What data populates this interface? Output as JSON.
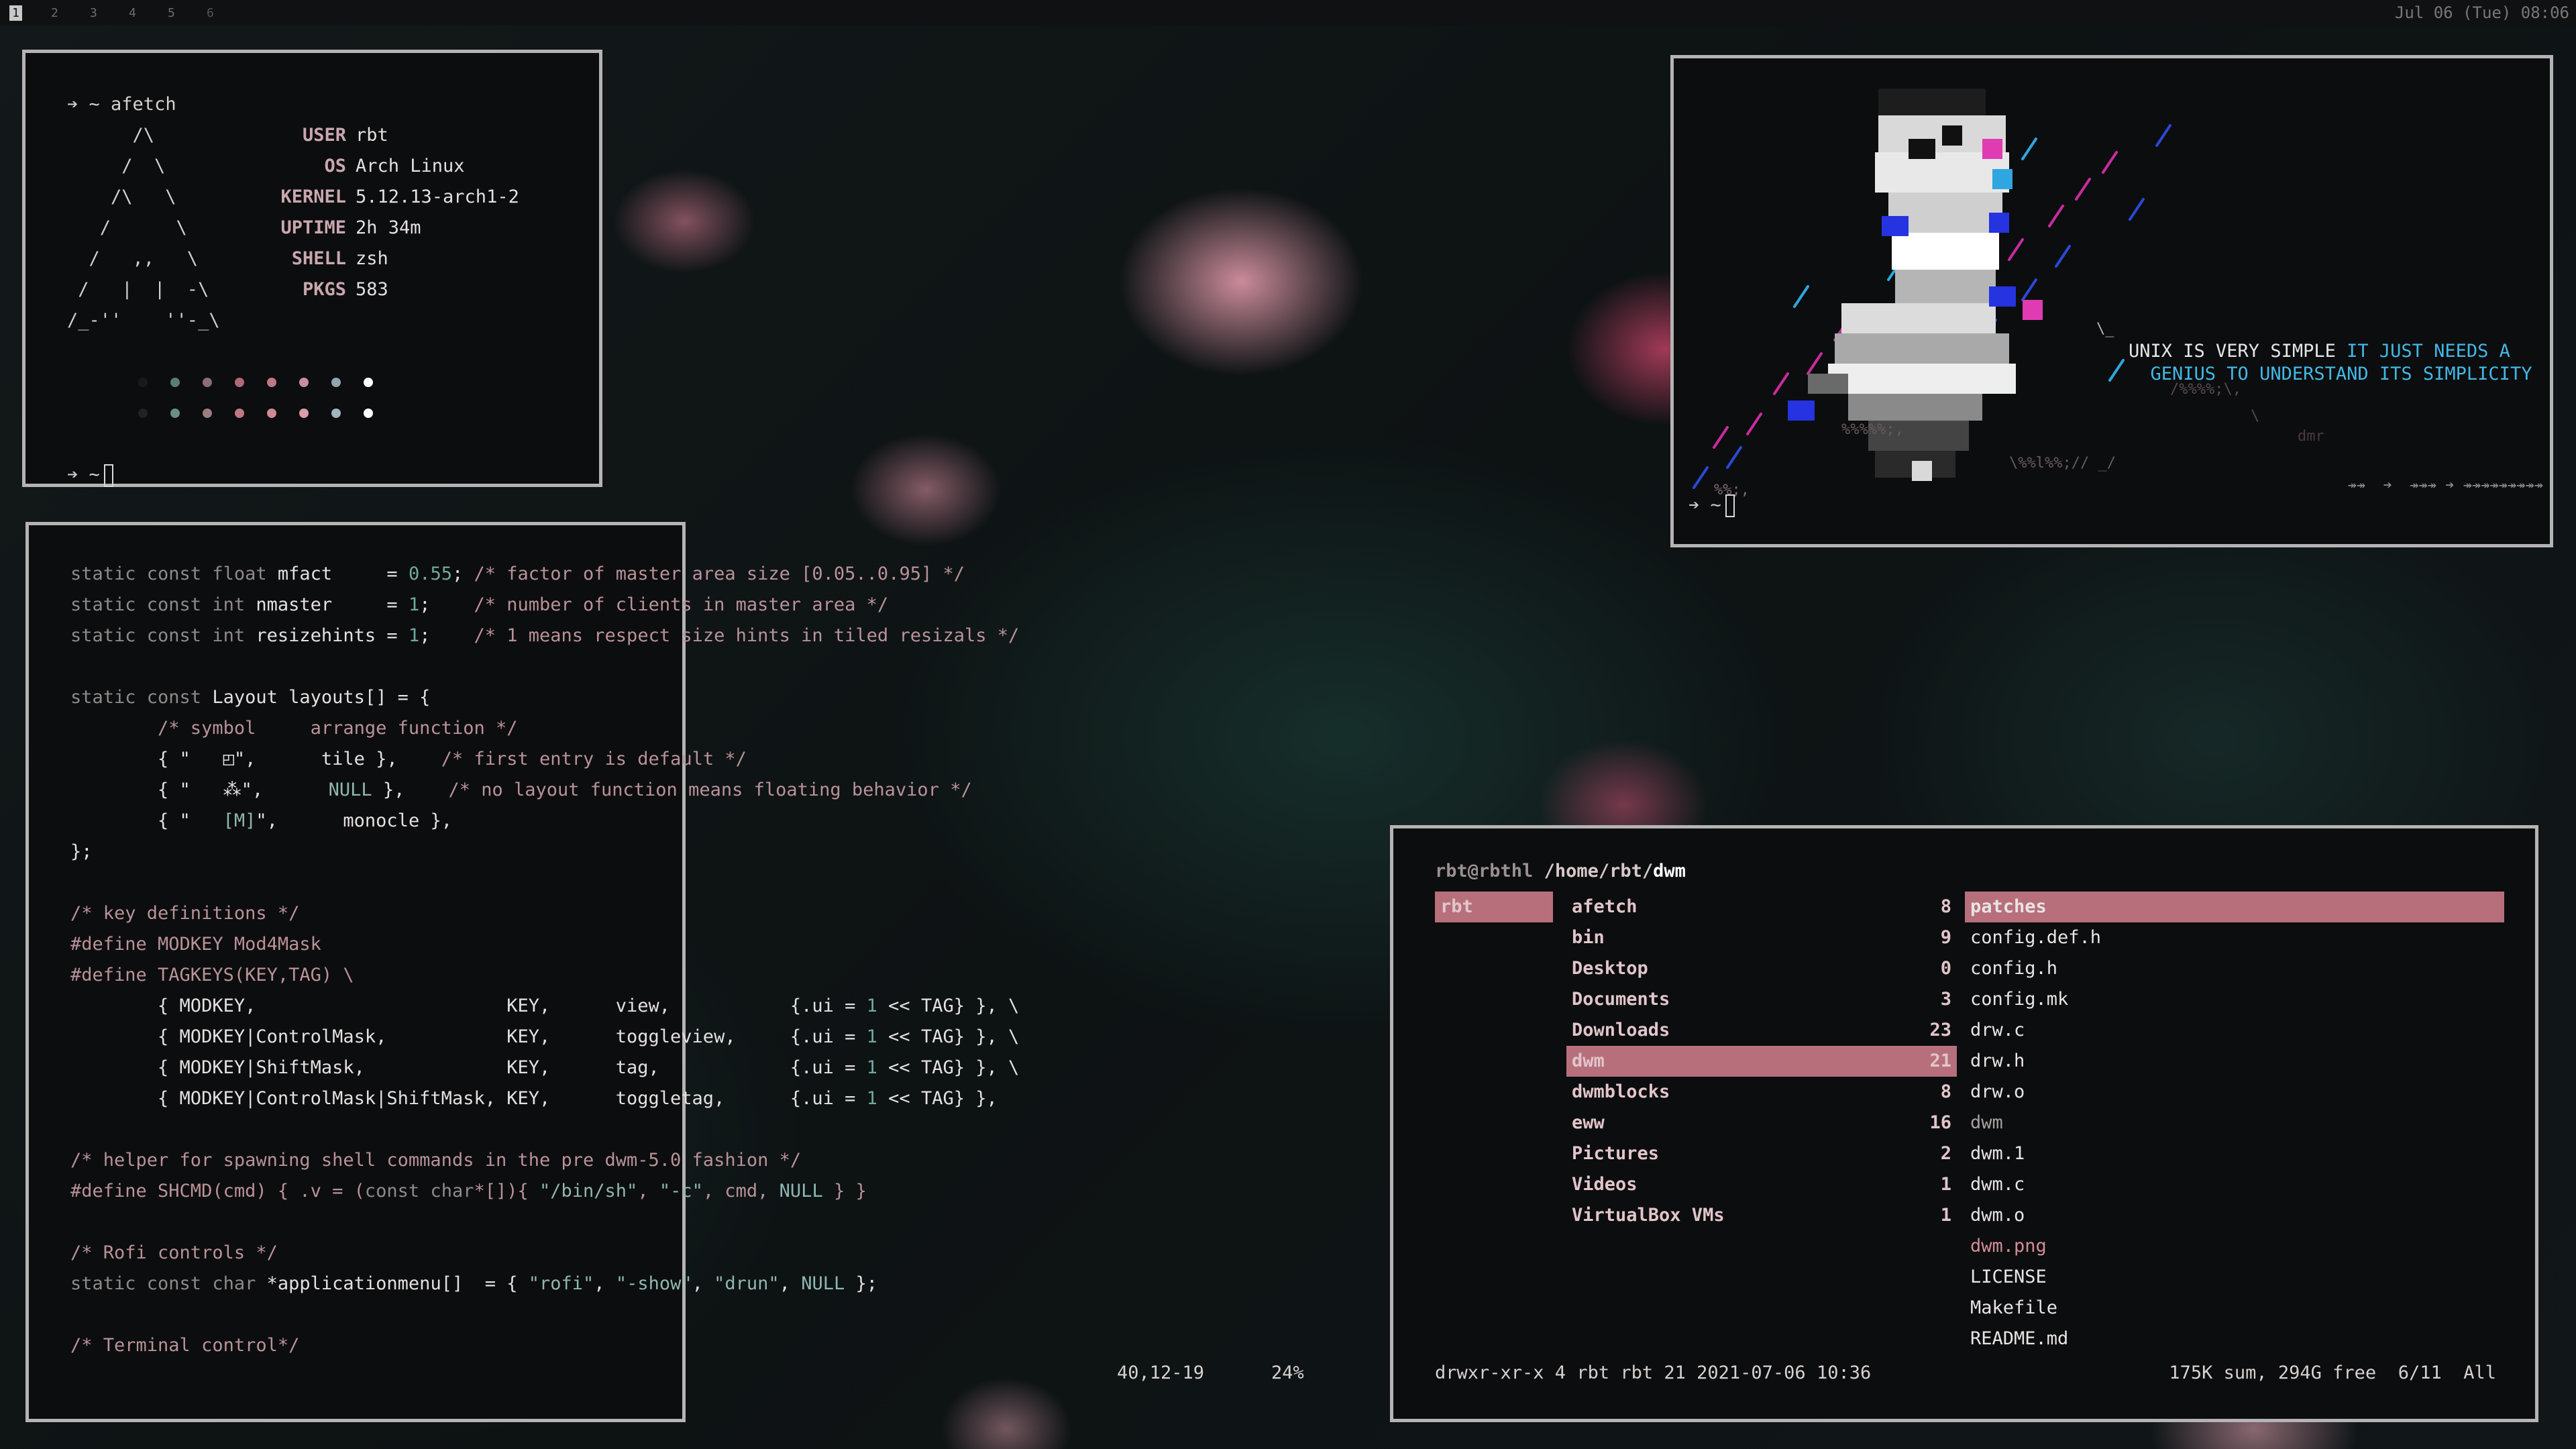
{
  "bar": {
    "tags": [
      "1",
      "2",
      "3",
      "4",
      "5",
      "6"
    ],
    "clock": "Jul 06 (Tue) 08:06"
  },
  "afetch": {
    "prompt_arrow": "➔",
    "command": "~ afetch",
    "rows": [
      {
        "art": "      /\\",
        "key": "USER",
        "value": "rbt"
      },
      {
        "art": "     /  \\",
        "key": "OS",
        "value": "Arch Linux"
      },
      {
        "art": "    /\\   \\",
        "key": "KERNEL",
        "value": "5.12.13-arch1-2"
      },
      {
        "art": "   /      \\",
        "key": "UPTIME",
        "value": "2h 34m"
      },
      {
        "art": "  /   ,,   \\",
        "key": "SHELL",
        "value": "zsh"
      },
      {
        "art": " /   |  |  -\\",
        "key": "PKGS",
        "value": "583"
      },
      {
        "art": "/_-''    ''-_\\",
        "key": "",
        "value": ""
      }
    ],
    "palette_row1": [
      "#1a1a1a",
      "#5a7f72",
      "#8a6e72",
      "#b06878",
      "#c07888",
      "#c98e9c",
      "#8fa6ad",
      "#ffffff"
    ],
    "palette_row2": [
      "#222222",
      "#6a9082",
      "#9a7e82",
      "#c07888",
      "#d08898",
      "#d99eac",
      "#9fb6bd",
      "#ffffff"
    ],
    "prompt_tilde": "~"
  },
  "art": {
    "quote_white_1": "UNIX IS VERY SIMPLE ",
    "quote_cyan_1": "IT JUST NEEDS A",
    "quote_cyan_2": "  GENIUS TO UNDERSTAND ITS SIMPLICITY",
    "prompt_arrow": "➔",
    "prompt_tilde": "~",
    "arrows": "↠↠  ➔  ↠↠↠ ➔ ↠↠↠↠↠↠↠↠↠"
  },
  "editor": {
    "l1": {
      "a": "static const float ",
      "b": "mfact",
      "c": "     = ",
      "d": "0.55",
      "e": "; ",
      "f": "/* factor of master area size [0.05..0.95] */"
    },
    "l2": {
      "a": "static const int ",
      "b": "nmaster",
      "c": "     = ",
      "d": "1",
      "e": ";    ",
      "f": "/* number of clients in master area */"
    },
    "l3": {
      "a": "static const int ",
      "b": "resizehints",
      "c": " = ",
      "d": "1",
      "e": ";    ",
      "f": "/* 1 means respect size hints in tiled resizals */"
    },
    "l5": {
      "a": "static const ",
      "b": "Layout layouts[] = {"
    },
    "l6": "        /* symbol     arrange function */",
    "l7": {
      "a": "        { \"   ◰\",      ",
      "b": "tile",
      "c": " },    ",
      "d": "/* first entry is default */"
    },
    "l8": {
      "a": "        { \"   ⁂\",      ",
      "b": "NULL",
      "c": " },    ",
      "d": "/* no layout function means floating behavior */"
    },
    "l9": {
      "a": "        { \"   ",
      "b": "[M]",
      "c": "\",      ",
      "d": "monocle",
      "e": " },"
    },
    "l10": "};",
    "l12": "/* key definitions */",
    "l13": "#define MODKEY Mod4Mask",
    "l14": "#define TAGKEYS(KEY,TAG) \\",
    "l15": {
      "a": "        { MODKEY,                       KEY,      view,           {.ui = ",
      "b": "1",
      "c": " << TAG} }, \\"
    },
    "l16": {
      "a": "        { MODKEY|ControlMask,           KEY,      toggleview,     {.ui = ",
      "b": "1",
      "c": " << TAG} }, \\"
    },
    "l17": {
      "a": "        { MODKEY|ShiftMask,             KEY,      tag,            {.ui = ",
      "b": "1",
      "c": " << TAG} }, \\"
    },
    "l18": {
      "a": "        { MODKEY|ControlMask|ShiftMask, KEY,      toggletag,      {.ui = ",
      "b": "1",
      "c": " << TAG} },"
    },
    "l20": "/* helper for spawning shell commands in the pre dwm-5.0 fashion */",
    "l21": {
      "a": "#define SHCMD(cmd) { .v = (",
      "b": "const char",
      "c": "*[]){ ",
      "d": "\"/bin/sh\"",
      "e": ", ",
      "f": "\"-c\"",
      "g": ", cmd, ",
      "h": "NULL",
      "i": " } }"
    },
    "l23": "/* Rofi controls */",
    "l24": {
      "a": "static const char ",
      "b": "*applicationmenu[]  = { ",
      "c": "\"rofi\"",
      "d": ", ",
      "e": "\"-show\"",
      "f": ", ",
      "g": "\"drun\"",
      "h": ", ",
      "i": "NULL",
      "j": " };"
    },
    "l26": "/* Terminal control*/",
    "status_pos": "40,12-19",
    "status_pct": "24%"
  },
  "fm": {
    "user": "rbt@rbthl",
    "path": " /home/rbt/",
    "dir": "dwm",
    "parent": [
      {
        "name": "rbt",
        "selected": true
      }
    ],
    "dirs": [
      {
        "name": "afetch",
        "count": "8"
      },
      {
        "name": "bin",
        "count": "9"
      },
      {
        "name": "Desktop",
        "count": "0"
      },
      {
        "name": "Documents",
        "count": "3"
      },
      {
        "name": "Downloads",
        "count": "23"
      },
      {
        "name": "dwm",
        "count": "21",
        "selected": true
      },
      {
        "name": "dwmblocks",
        "count": "8"
      },
      {
        "name": "eww",
        "count": "16"
      },
      {
        "name": "Pictures",
        "count": "2"
      },
      {
        "name": "Videos",
        "count": "1"
      },
      {
        "name": "VirtualBox VMs",
        "count": "1"
      }
    ],
    "files": [
      {
        "name": "patches",
        "selected": true
      },
      {
        "name": "config.def.h"
      },
      {
        "name": "config.h"
      },
      {
        "name": "config.mk"
      },
      {
        "name": "drw.c"
      },
      {
        "name": "drw.h"
      },
      {
        "name": "drw.o"
      },
      {
        "name": "dwm",
        "dim": true
      },
      {
        "name": "dwm.1"
      },
      {
        "name": "dwm.c"
      },
      {
        "name": "dwm.o"
      },
      {
        "name": "dwm.png",
        "pink": true
      },
      {
        "name": "LICENSE"
      },
      {
        "name": "Makefile"
      },
      {
        "name": "README.md"
      }
    ],
    "footer_left": "drwxr-xr-x 4 rbt rbt 21 2021-07-06 10:36",
    "footer_right": "175K sum, 294G free  6/11  All"
  }
}
